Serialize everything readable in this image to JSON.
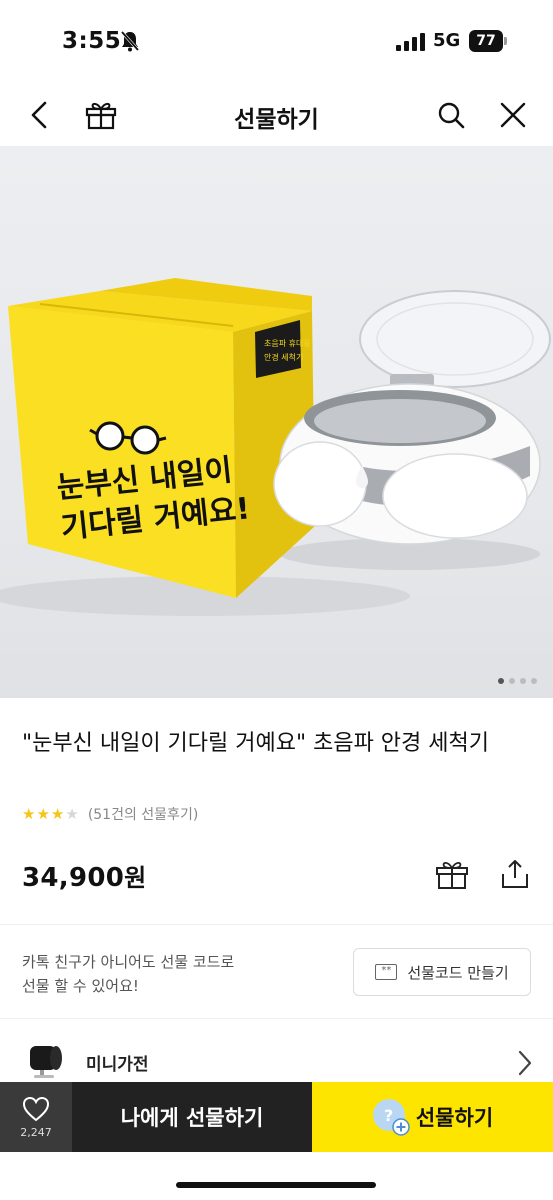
{
  "status_bar": {
    "time": "3:55",
    "network": "5G",
    "battery": "77"
  },
  "header": {
    "title": "선물하기"
  },
  "hero": {
    "box_tag_line1": "초음파 휴대용",
    "box_tag_line2": "안경 세척기",
    "box_slogan_line1": "눈부신 내일이",
    "box_slogan_line2": "기다릴 거예요!",
    "page_count": 4,
    "active_page": 1
  },
  "product": {
    "title": "\"눈부신 내일이 기다릴 거예요\" 초음파 안경 세척기",
    "rating": 3,
    "rating_max": 5,
    "review_text": "(51건의 선물후기)",
    "price": "34,900",
    "price_unit": "원"
  },
  "gift_code": {
    "line1": "카톡 친구가 아니어도 선물 코드로",
    "line2": "선물 할 수 있어요!",
    "button_label": "선물코드 만들기",
    "button_icon_text": "**"
  },
  "category": {
    "label": "미니가전"
  },
  "bottom_bar": {
    "wish_count": "2,247",
    "gift_self_label": "나에게 선물하기",
    "gift_label": "선물하기",
    "avatar_mark": "?"
  },
  "colors": {
    "brand_yellow": "#fee500",
    "dark_button": "#222222",
    "wish_bg": "#3a3a3a",
    "star_on": "#f5c518"
  }
}
